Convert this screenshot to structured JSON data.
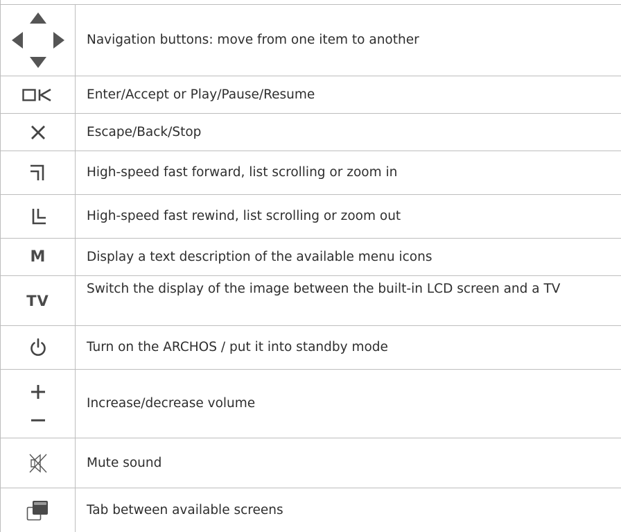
{
  "table": {
    "rows": [
      {
        "icon": "navigation-arrows-icon",
        "description": "Navigation buttons: move from one item to another"
      },
      {
        "icon": "ok-icon",
        "icon_text": "OK",
        "description": "Enter/Accept or Play/Pause/Resume"
      },
      {
        "icon": "close-x-icon",
        "description": "Escape/Back/Stop"
      },
      {
        "icon": "fast-forward-corner-icon",
        "description": "High-speed fast forward, list scrolling or zoom in"
      },
      {
        "icon": "rewind-corner-icon",
        "description": "High-speed fast rewind, list scrolling or zoom out"
      },
      {
        "icon": "menu-m-icon",
        "icon_text": "M",
        "description": "Display a text description of the available menu icons"
      },
      {
        "icon": "tv-icon",
        "icon_text": "TV",
        "description": "Switch the display of the image between the built-in LCD screen and a TV"
      },
      {
        "icon": "power-icon",
        "description": "Turn on the ARCHOS / put it into standby mode"
      },
      {
        "icon": "volume-plus-minus-icon",
        "description": "Increase/decrease volume"
      },
      {
        "icon": "mute-icon",
        "description": "Mute sound"
      },
      {
        "icon": "screens-tab-icon",
        "description": "Tab between available screens"
      }
    ]
  }
}
